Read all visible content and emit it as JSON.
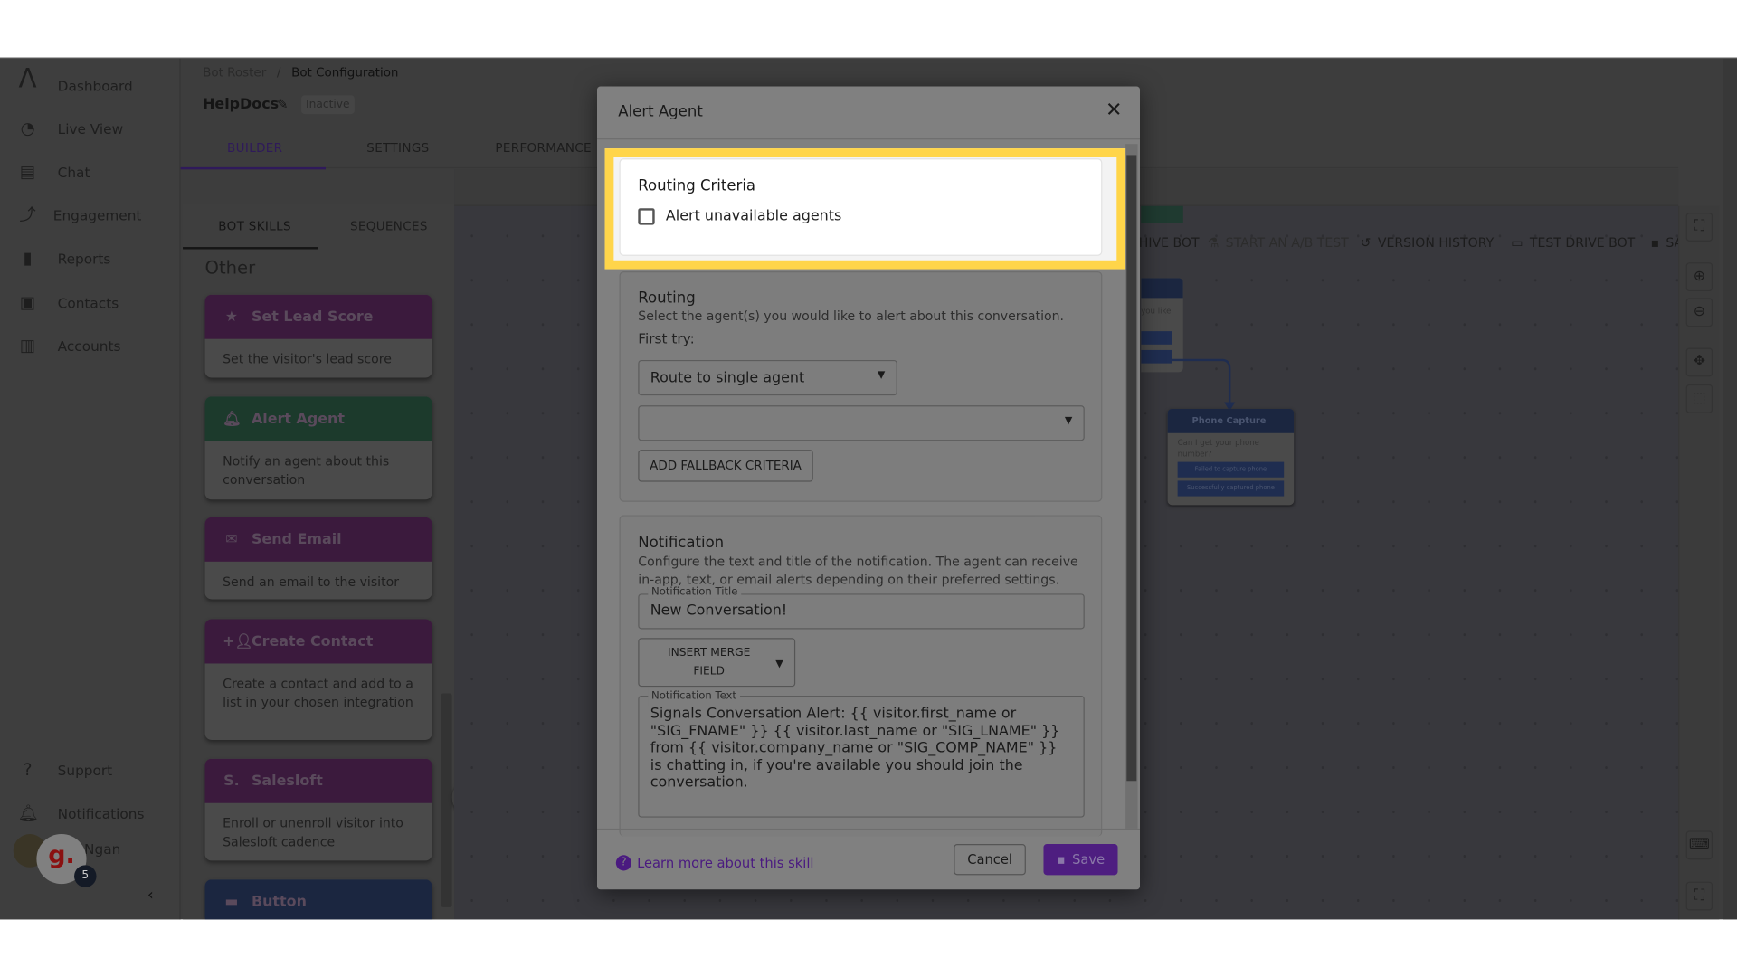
{
  "sidebar": {
    "items": [
      {
        "label": "Dashboard",
        "icon": "logo-icon"
      },
      {
        "label": "Live View",
        "icon": "live-view-icon"
      },
      {
        "label": "Chat",
        "icon": "chat-icon"
      },
      {
        "label": "Engagement",
        "icon": "engagement-icon"
      },
      {
        "label": "Reports",
        "icon": "reports-icon"
      },
      {
        "label": "Contacts",
        "icon": "contacts-icon"
      },
      {
        "label": "Accounts",
        "icon": "accounts-icon"
      }
    ],
    "bottom": [
      {
        "label": "Support",
        "icon": "help-icon"
      },
      {
        "label": "Notifications",
        "icon": "bell-icon"
      }
    ],
    "user": {
      "name": "Ngan",
      "badge_count": "5",
      "widget_letter": "g."
    }
  },
  "header": {
    "breadcrumb": [
      "Bot Roster",
      "Bot Configuration"
    ],
    "bot_name": "HelpDocs",
    "status": "Inactive",
    "tabs": [
      "BUILDER",
      "SETTINGS",
      "PERFORMANCE"
    ],
    "active_tab": "BUILDER"
  },
  "skills_panel": {
    "tabs": [
      "BOT SKILLS",
      "SEQUENCES"
    ],
    "active_tab": "BOT SKILLS",
    "section": "Other",
    "cards": [
      {
        "title": "Set Lead Score",
        "desc": "Set the visitor's lead score",
        "icon": "star-icon",
        "color": "#3b1a3d"
      },
      {
        "title": "Alert Agent",
        "desc": "Notify an agent about this conversation",
        "icon": "bell-icon",
        "color": "#1c3a2c"
      },
      {
        "title": "Send Email",
        "desc": "Send an email to the visitor",
        "icon": "mail-icon",
        "color": "#3b1a3d"
      },
      {
        "title": "Create Contact",
        "desc": "Create a contact and add to a list in your chosen integration",
        "icon": "add-person-icon",
        "color": "#3b1a3d"
      },
      {
        "title": "Salesloft",
        "desc": "Enroll or unenroll visitor into Salesloft cadence",
        "icon": "salesloft-icon",
        "color": "#3b1a3d"
      },
      {
        "title": "Button",
        "desc": "",
        "icon": "button-icon",
        "color": "#1b2640"
      }
    ]
  },
  "toolbar": {
    "archive": "HIVE BOT",
    "ab_test": "START AN A/B TEST",
    "version_history": "VERSION HISTORY",
    "test_drive": "TEST DRIVE BOT",
    "save": "SAVE"
  },
  "canvas": {
    "node_partial_text": "you like",
    "phone_node": {
      "title": "Phone Capture",
      "question": "Can I get your phone number?",
      "buttons": [
        "Failed to capture phone",
        "Successfully captured phone"
      ]
    }
  },
  "modal": {
    "title": "Alert Agent",
    "routing_criteria": {
      "title": "Routing Criteria",
      "checkbox_label": "Alert unavailable agents",
      "checked": false
    },
    "routing": {
      "title": "Routing",
      "desc": "Select the agent(s) you would like to alert about this conversation.",
      "first_try": "First try:",
      "route_select": "Route to single agent",
      "agent_select": "",
      "fallback_button": "ADD FALLBACK CRITERIA"
    },
    "notification": {
      "title": "Notification",
      "desc": "Configure the text and title of the notification. The agent can receive in-app, text, or email alerts depending on their preferred settings.",
      "title_label": "Notification Title",
      "title_value": "New Conversation!",
      "merge_button": "INSERT MERGE FIELD",
      "text_label": "Notification Text",
      "text_value": "Signals Conversation Alert: {{ visitor.first_name or \"SIG_FNAME\" }} {{ visitor.last_name or \"SIG_LNAME\" }} from {{ visitor.company_name or \"SIG_COMP_NAME\" }} is chatting in, if you're available you should join the conversation."
    },
    "learn_more": "Learn more about this skill",
    "cancel": "Cancel",
    "save": "Save"
  },
  "colors": {
    "highlight": "#ffd54a",
    "primary": "#4e1e80"
  }
}
